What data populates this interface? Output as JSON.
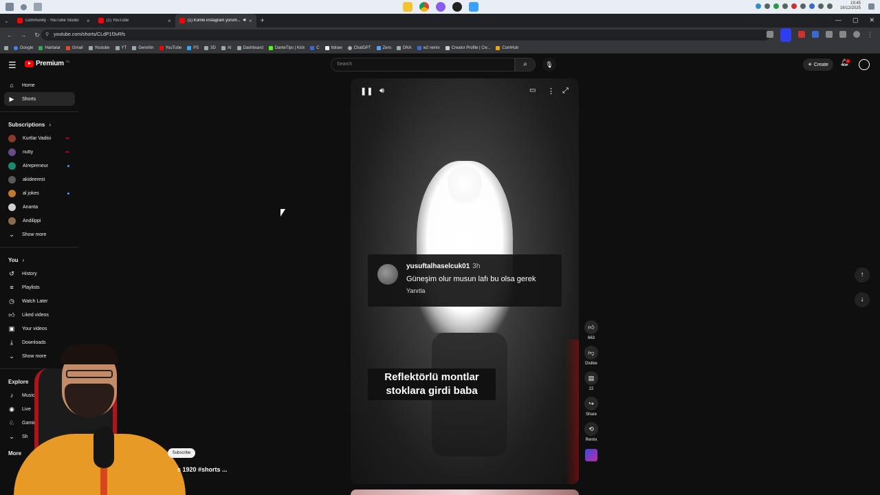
{
  "os": {
    "clock_time": "19:45",
    "clock_date": "16/12/2025"
  },
  "browser": {
    "tabs": [
      {
        "title": "Community - YouTube Studio",
        "close": "×"
      },
      {
        "title": "(1) YouTube",
        "close": "×"
      },
      {
        "title": "(1) Komik instagram yorum...",
        "close": "×"
      }
    ],
    "new_tab": "+",
    "url": "youtube.com/shorts/CLdP1f3vRfs",
    "bookmarks": [
      "Google",
      "Haritalar",
      "Gmail",
      "Youtube",
      "YT",
      "Genshin",
      "YouTube",
      "PS",
      "3D",
      "AI",
      "Dashboard",
      "DanteTips | Kick",
      "C",
      "tldraw",
      "ChatGPT",
      "Zero",
      "DNA",
      "w2 remix",
      "Creator Profile | Civ...",
      "ComHub"
    ],
    "window_controls": {
      "minimize": "—",
      "maximize": "▢",
      "close": "✕"
    }
  },
  "header": {
    "logo_text": "Premium",
    "logo_sup": "TR",
    "search_placeholder": "Search",
    "create_label": "Create",
    "notification_count": "1"
  },
  "sidebar": {
    "main": [
      {
        "label": "Home",
        "icon": "home-icon"
      },
      {
        "label": "Shorts",
        "icon": "shorts-icon"
      }
    ],
    "subscriptions_heading": "Subscriptions",
    "subscriptions": [
      {
        "label": "Kurtlar Vadisi",
        "color": "#8a3a2a",
        "dot": "#cc0000"
      },
      {
        "label": "nutty",
        "color": "#6a4a8a",
        "dot": "#cc0000"
      },
      {
        "label": "AIrepreneur",
        "color": "#1a8a6a",
        "dot": "#3ea6ff"
      },
      {
        "label": "akideerest",
        "color": "#5a5a5a",
        "dot": ""
      },
      {
        "label": "al jokes",
        "color": "#c07a30",
        "dot": "#3ea6ff"
      },
      {
        "label": "Ananta",
        "color": "#d0d0d0",
        "dot": ""
      },
      {
        "label": "Andilippi",
        "color": "#8a6a4a",
        "dot": ""
      }
    ],
    "subs_show_more": "Show more",
    "you_heading": "You",
    "you_items": [
      {
        "label": "History",
        "icon": "history-icon"
      },
      {
        "label": "Playlists",
        "icon": "playlists-icon"
      },
      {
        "label": "Watch Later",
        "icon": "clock-icon"
      },
      {
        "label": "Liked videos",
        "icon": "thumbs-up-icon"
      },
      {
        "label": "Your videos",
        "icon": "play-square-icon"
      },
      {
        "label": "Downloads",
        "icon": "download-icon"
      }
    ],
    "you_show_more": "Show more",
    "explore_heading": "Explore",
    "explore_items": [
      {
        "label": "Music",
        "icon": "music-icon"
      },
      {
        "label": "Live",
        "icon": "live-icon"
      },
      {
        "label": "Gaming",
        "icon": "gaming-icon"
      },
      {
        "label": "Sh",
        "icon": "chevron-down-icon"
      }
    ],
    "more_heading": "More"
  },
  "player": {
    "comment_user": "yusuftalhaselcuk01",
    "comment_time": "3h",
    "comment_text": "Güneşim olur musun lafı bu olsa gerek",
    "comment_reply": "Yanıtla",
    "caption_line1": "Reflektörlü montlar",
    "caption_line2": "stoklara girdi baba"
  },
  "actions": {
    "like_count": "663",
    "dislike_label": "Dislike",
    "comment_count": "22",
    "share_label": "Share",
    "remix_label": "Remix"
  },
  "webcam_overlay": {
    "subscribe_label": "Subscribe",
    "title_fragment": "s 1920 #shorts ..."
  }
}
